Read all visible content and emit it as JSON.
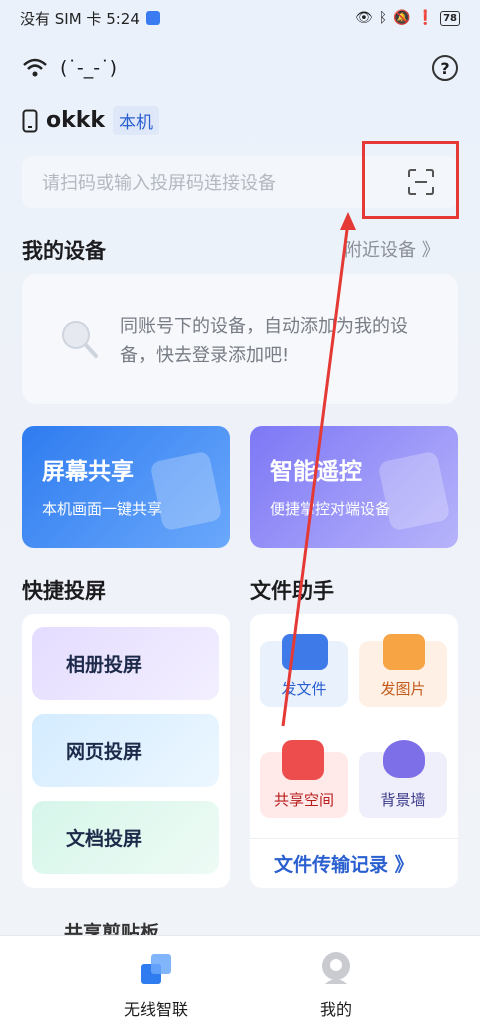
{
  "status": {
    "carrier_time": "没有 SIM 卡 5:24",
    "battery": "78"
  },
  "wifi": {
    "name": "(˙-_-˙)"
  },
  "device": {
    "name": "okkk",
    "badge": "本机"
  },
  "search": {
    "placeholder": "请扫码或输入投屏码连接设备"
  },
  "my_devices": {
    "title": "我的设备",
    "nearby": "附近设备 》",
    "empty_text": "同账号下的设备，自动添加为我的设备，快去登录添加吧!"
  },
  "cards": [
    {
      "title": "屏幕共享",
      "subtitle": "本机画面一键共享"
    },
    {
      "title": "智能遥控",
      "subtitle": "便捷掌控对端设备"
    }
  ],
  "quick_cast": {
    "title": "快捷投屏",
    "items": [
      "相册投屏",
      "网页投屏",
      "文档投屏"
    ]
  },
  "file_helper": {
    "title": "文件助手",
    "items": [
      "发文件",
      "发图片",
      "共享空间",
      "背景墙"
    ],
    "records": "文件传输记录 》"
  },
  "partial_section": "共享剪贴板",
  "tabs": [
    {
      "label": "无线智联"
    },
    {
      "label": "我的"
    }
  ],
  "colors": {
    "accent": "#2a5fd0",
    "annotation": "#e53935"
  }
}
